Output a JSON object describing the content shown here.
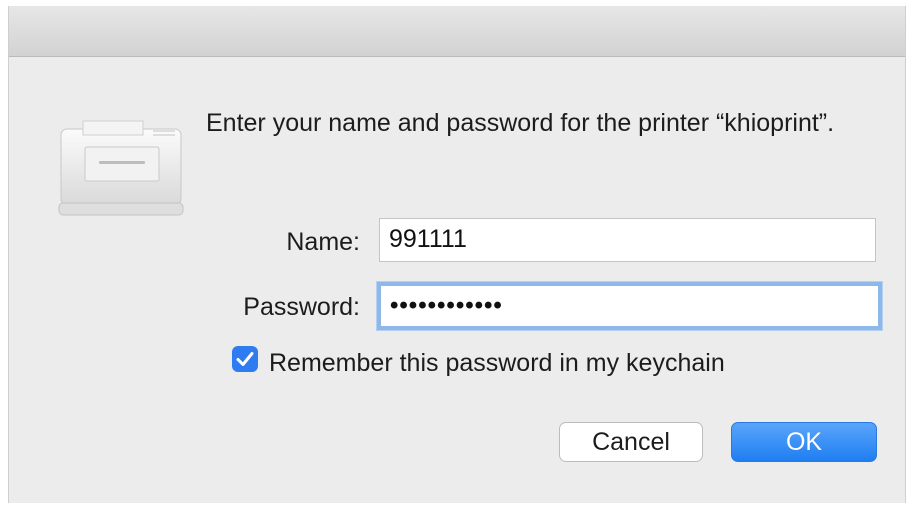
{
  "dialog": {
    "message": "Enter your name and password for the printer “khioprint”.",
    "name_label": "Name:",
    "name_value": "991111",
    "password_label": "Password:",
    "password_value": "••••••••••••",
    "remember_label": "Remember this password in my keychain",
    "remember_checked": true,
    "cancel_label": "Cancel",
    "ok_label": "OK",
    "icon": "printer-icon",
    "accent_color": "#2f7cf0"
  }
}
